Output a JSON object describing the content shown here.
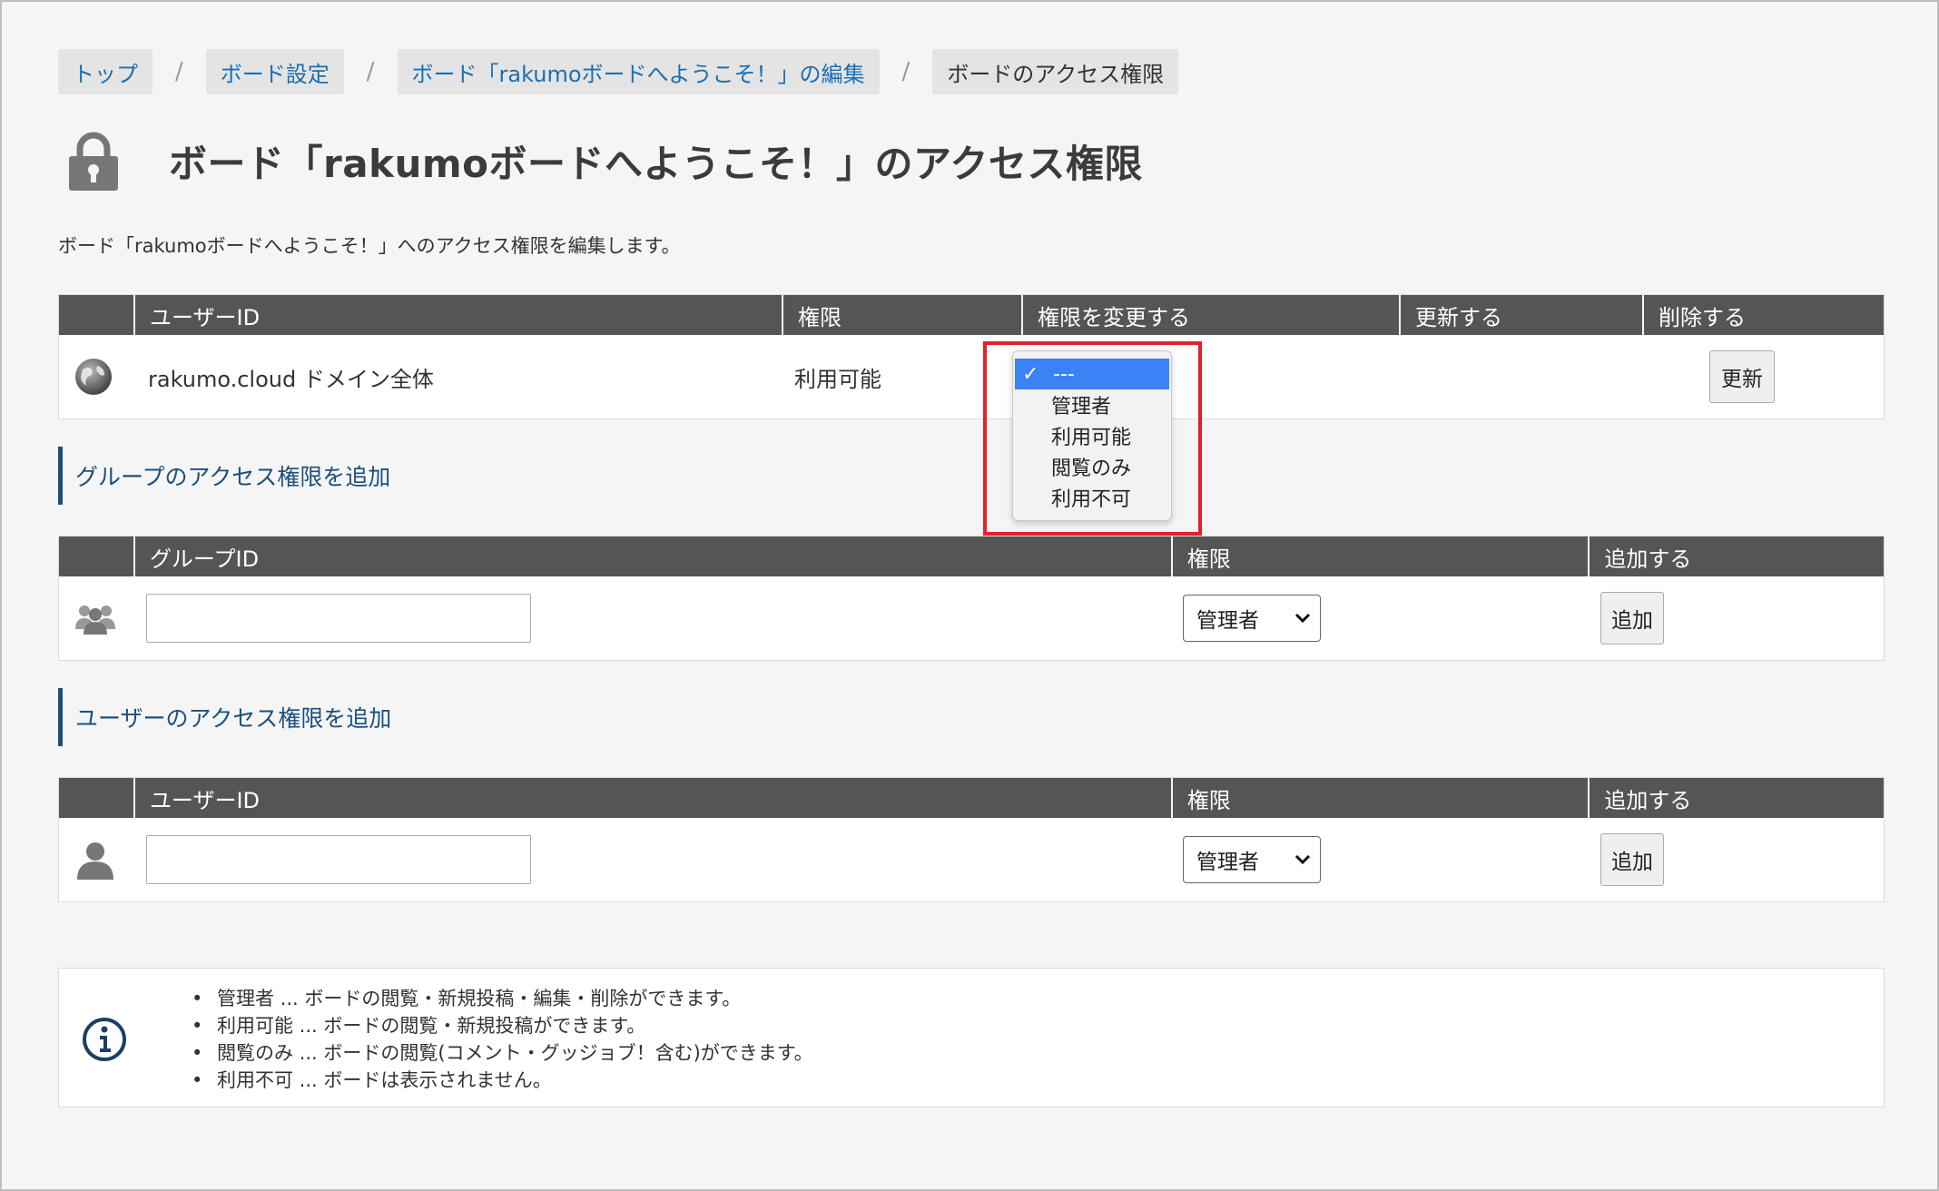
{
  "breadcrumb": {
    "items": [
      "トップ",
      "ボード設定",
      "ボード「rakumoボードへようこそ！」の編集"
    ],
    "current": "ボードのアクセス権限",
    "separator": "/"
  },
  "page": {
    "title": "ボード「rakumoボードへようこそ！」のアクセス権限",
    "description": "ボード「rakumoボードへようこそ！」へのアクセス権限を編集します。"
  },
  "access_table": {
    "headers": [
      "",
      "ユーザーID",
      "権限",
      "権限を変更する",
      "更新する",
      "削除する"
    ],
    "rows": [
      {
        "icon": "globe-icon",
        "user_id": "rakumo.cloud ドメイン全体",
        "permission": "利用可能",
        "update_button": "更新"
      }
    ]
  },
  "permission_dropdown": {
    "options": [
      "---",
      "管理者",
      "利用可能",
      "閲覧のみ",
      "利用不可"
    ],
    "selected": "---",
    "check": "✓"
  },
  "group_section": {
    "title": "グループのアクセス権限を追加",
    "headers": [
      "",
      "グループID",
      "権限",
      "追加する"
    ],
    "input_value": "",
    "select_value": "管理者",
    "add_button": "追加"
  },
  "user_section": {
    "title": "ユーザーのアクセス権限を追加",
    "headers": [
      "",
      "ユーザーID",
      "権限",
      "追加する"
    ],
    "input_value": "",
    "select_value": "管理者",
    "add_button": "追加"
  },
  "info": {
    "items": [
      "管理者 ... ボードの閲覧・新規投稿・編集・削除ができます。",
      "利用可能 ... ボードの閲覧・新規投稿ができます。",
      "閲覧のみ ... ボードの閲覧(コメント・グッジョブ！含む)ができます。",
      "利用不可 ... ボードは表示されません。"
    ]
  },
  "colors": {
    "header_bg": "#555555",
    "link": "#1a6fb3",
    "section_accent": "#1c4f7c",
    "highlight_border": "#e0222b",
    "selected_option": "#3a82f5"
  }
}
